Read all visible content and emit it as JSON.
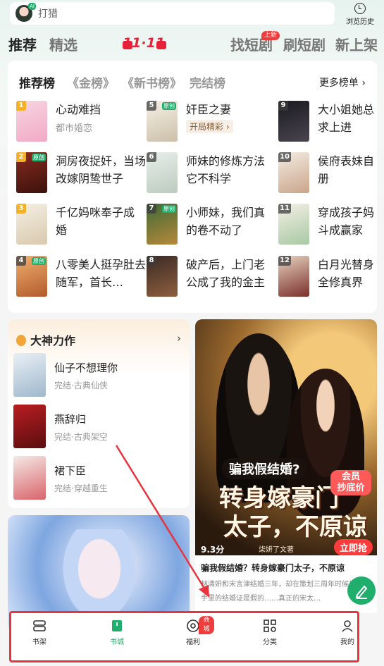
{
  "search": {
    "placeholder": "打猎",
    "ai_badge": "AI",
    "history_label": "浏览历史"
  },
  "top_nav": {
    "tabs": [
      "推荐",
      "精选",
      "找短剧",
      "刷短剧",
      "新上架"
    ],
    "promo": "11·11",
    "new_badge": "上新"
  },
  "ranking": {
    "tabs": [
      "推荐榜",
      "《金榜》",
      "《新书榜》",
      "完结榜"
    ],
    "more": "更多榜单 ›",
    "items": [
      {
        "num": "1",
        "title": "心动难挡",
        "sub": "都市婚恋",
        "tag": "",
        "orig": ""
      },
      {
        "num": "2",
        "title": "洞房夜捉奸，当场改嫁阴鸷世子",
        "sub": "",
        "tag": "",
        "orig": "原创"
      },
      {
        "num": "3",
        "title": "千亿妈咪奉子成婚",
        "sub": "",
        "tag": "",
        "orig": ""
      },
      {
        "num": "4",
        "title": "八零美人挺孕肚去随军，首长…",
        "sub": "",
        "tag": "",
        "orig": "原创"
      },
      {
        "num": "5",
        "title": "奸臣之妻",
        "sub": "",
        "tag": "开局精彩 ›",
        "orig": "原创"
      },
      {
        "num": "6",
        "title": "师妹的修炼方法它不科学",
        "sub": "",
        "tag": "",
        "orig": ""
      },
      {
        "num": "7",
        "title": "小师妹，我们真的卷不动了",
        "sub": "",
        "tag": "",
        "orig": "原创"
      },
      {
        "num": "8",
        "title": "破产后，上门老公成了我的金主",
        "sub": "",
        "tag": "",
        "orig": ""
      },
      {
        "num": "9",
        "title": "大小姐她总求上进",
        "sub": "",
        "tag": "",
        "orig": ""
      },
      {
        "num": "10",
        "title": "侯府表妹自册",
        "sub": "",
        "tag": "",
        "orig": ""
      },
      {
        "num": "11",
        "title": "穿成孩子妈斗成赢家",
        "sub": "",
        "tag": "",
        "orig": ""
      },
      {
        "num": "12",
        "title": "白月光替身全修真界",
        "sub": "",
        "tag": "",
        "orig": ""
      }
    ]
  },
  "masters": {
    "title": "大神力作",
    "arrow": "›",
    "items": [
      {
        "title": "仙子不想理你",
        "sub": "完结·古典仙侠"
      },
      {
        "title": "燕辞归",
        "sub": "完结·古典架空"
      },
      {
        "title": "裙下臣",
        "sub": "完结·穿越重生"
      }
    ]
  },
  "promo_book": {
    "headline": "骗我假结婚?",
    "big_line1": "转身嫁豪门",
    "big_line2": "太子，不原谅",
    "score": "9.3分",
    "author": "柒妍了文著",
    "vip_line1": "会员",
    "vip_line2": "抄底价",
    "buy": "立即抢",
    "title": "骗我假结婚？转身嫁豪门太子，不原谅",
    "desc": "林清妍和宋言津结婚三年，却在策划三周年时候发现她手里的结婚证是假的……真正的宋太…"
  },
  "fab": {
    "icon": "pen-icon"
  },
  "bottom_nav": {
    "items": [
      {
        "label": "书架",
        "icon": "bookshelf-icon"
      },
      {
        "label": "书城",
        "icon": "bookstore-icon"
      },
      {
        "label": "福利",
        "icon": "welfare-icon",
        "badge": "商城"
      },
      {
        "label": "分类",
        "icon": "category-icon"
      },
      {
        "label": "我的",
        "icon": "profile-icon"
      }
    ],
    "active": "书城"
  },
  "colors": {
    "accent": "#1fae6b",
    "promo_red": "#e6223a",
    "highlight_border": "#e8343f"
  }
}
